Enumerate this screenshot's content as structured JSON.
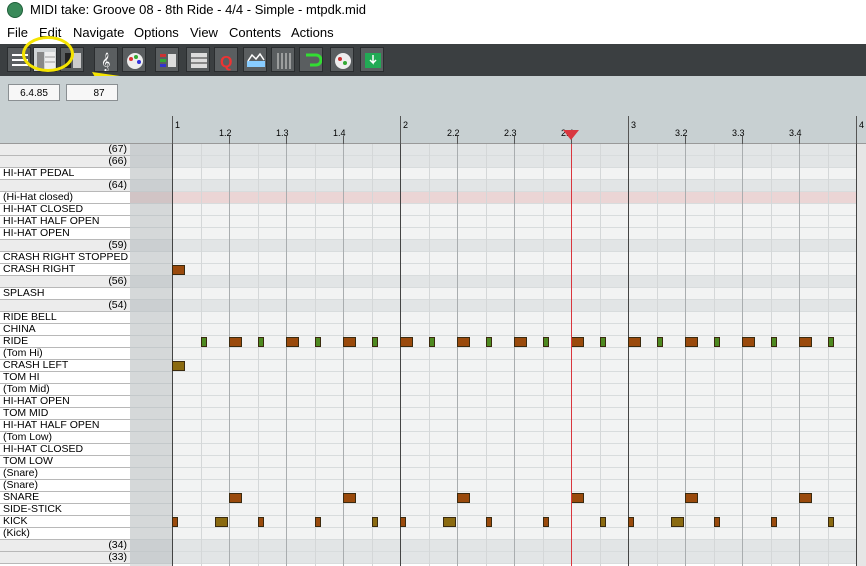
{
  "window": {
    "title": "MIDI take: Groove 08 - 8th Ride - 4/4 - Simple - mtpdk.mid"
  },
  "menu": [
    "File",
    "Edit",
    "Navigate",
    "Options",
    "View",
    "Contents",
    "Actions"
  ],
  "toolbar": {
    "buttons": [
      {
        "name": "piano-roll-mode-icon",
        "active": false
      },
      {
        "name": "named-notes-mode-icon",
        "active": true
      },
      {
        "name": "drum-grid-mode-icon",
        "active": false
      },
      {
        "name": "musical-notation-icon",
        "active": false
      },
      {
        "name": "color-palette-icon",
        "active": false
      },
      {
        "name": "velocity-color-icon",
        "active": false
      },
      {
        "name": "channel-grid-icon",
        "active": false
      },
      {
        "name": "quantize-icon",
        "active": false
      },
      {
        "name": "event-properties-icon",
        "active": false
      },
      {
        "name": "grid-lines-icon",
        "active": false
      },
      {
        "name": "loop-icon",
        "active": false
      },
      {
        "name": "step-input-icon",
        "active": false
      },
      {
        "name": "insert-note-icon",
        "active": false
      }
    ]
  },
  "info": {
    "position": "6.4.85",
    "length": "87"
  },
  "ruler": {
    "labels": [
      "1",
      "1.2",
      "1.3",
      "1.4",
      "2",
      "2.2",
      "2.3",
      "2.4",
      "3",
      "3.2",
      "3.3",
      "3.4",
      "4"
    ]
  },
  "keys": [
    {
      "name": "",
      "num": "(67)",
      "shade": "light"
    },
    {
      "name": "",
      "num": "(66)",
      "shade": "light"
    },
    {
      "name": "HI-HAT PEDAL",
      "num": "",
      "shade": "white"
    },
    {
      "name": "",
      "num": "(64)",
      "shade": "light"
    },
    {
      "name": "(Hi-Hat closed)",
      "num": "",
      "shade": "white"
    },
    {
      "name": "HI-HAT CLOSED",
      "num": "",
      "shade": "white"
    },
    {
      "name": "HI-HAT HALF OPEN",
      "num": "",
      "shade": "white"
    },
    {
      "name": "HI-HAT OPEN",
      "num": "",
      "shade": "white"
    },
    {
      "name": "",
      "num": "(59)",
      "shade": "light"
    },
    {
      "name": "CRASH RIGHT STOPPED",
      "num": "",
      "shade": "white"
    },
    {
      "name": "CRASH RIGHT",
      "num": "",
      "shade": "white"
    },
    {
      "name": "",
      "num": "(56)",
      "shade": "light"
    },
    {
      "name": "SPLASH",
      "num": "",
      "shade": "white"
    },
    {
      "name": "",
      "num": "(54)",
      "shade": "light"
    },
    {
      "name": "RIDE BELL",
      "num": "",
      "shade": "white"
    },
    {
      "name": "CHINA",
      "num": "",
      "shade": "white"
    },
    {
      "name": "RIDE",
      "num": "",
      "shade": "white"
    },
    {
      "name": "(Tom Hi)",
      "num": "",
      "shade": "white"
    },
    {
      "name": "CRASH LEFT",
      "num": "",
      "shade": "white"
    },
    {
      "name": "TOM HI",
      "num": "",
      "shade": "white"
    },
    {
      "name": "(Tom Mid)",
      "num": "",
      "shade": "white"
    },
    {
      "name": "HI-HAT OPEN",
      "num": "",
      "shade": "white"
    },
    {
      "name": "TOM MID",
      "num": "",
      "shade": "white"
    },
    {
      "name": "HI-HAT HALF OPEN",
      "num": "",
      "shade": "white"
    },
    {
      "name": "(Tom Low)",
      "num": "",
      "shade": "white"
    },
    {
      "name": "HI-HAT CLOSED",
      "num": "",
      "shade": "white"
    },
    {
      "name": "TOM LOW",
      "num": "",
      "shade": "white"
    },
    {
      "name": "(Snare)",
      "num": "",
      "shade": "white"
    },
    {
      "name": "(Snare)",
      "num": "",
      "shade": "white"
    },
    {
      "name": "SNARE",
      "num": "",
      "shade": "white"
    },
    {
      "name": "SIDE-STICK",
      "num": "",
      "shade": "white"
    },
    {
      "name": "KICK",
      "num": "",
      "shade": "white"
    },
    {
      "name": "(Kick)",
      "num": "",
      "shade": "white"
    },
    {
      "name": "",
      "num": "(34)",
      "shade": "light"
    },
    {
      "name": "",
      "num": "(33)",
      "shade": "light"
    }
  ],
  "notes": [
    {
      "row": 10,
      "beat": 0.0,
      "len": 0.22,
      "color": "#9a4a0c"
    },
    {
      "row": 18,
      "beat": 0.0,
      "len": 0.22,
      "color": "#8a6a10"
    },
    {
      "row": 16,
      "beat": 0.5,
      "len": 0.1,
      "color": "#4e8a20"
    },
    {
      "row": 16,
      "beat": 1.0,
      "len": 0.22,
      "color": "#9a4a0c"
    },
    {
      "row": 16,
      "beat": 1.5,
      "len": 0.1,
      "color": "#4e8a20"
    },
    {
      "row": 16,
      "beat": 2.0,
      "len": 0.22,
      "color": "#9a4a0c"
    },
    {
      "row": 16,
      "beat": 2.5,
      "len": 0.1,
      "color": "#4e8a20"
    },
    {
      "row": 16,
      "beat": 3.0,
      "len": 0.22,
      "color": "#9a4a0c"
    },
    {
      "row": 16,
      "beat": 3.5,
      "len": 0.1,
      "color": "#4e8a20"
    },
    {
      "row": 16,
      "beat": 4.0,
      "len": 0.22,
      "color": "#9a4a0c"
    },
    {
      "row": 16,
      "beat": 4.5,
      "len": 0.1,
      "color": "#4e8a20"
    },
    {
      "row": 16,
      "beat": 5.0,
      "len": 0.22,
      "color": "#9a4a0c"
    },
    {
      "row": 16,
      "beat": 5.5,
      "len": 0.1,
      "color": "#4e8a20"
    },
    {
      "row": 16,
      "beat": 6.0,
      "len": 0.22,
      "color": "#9a4a0c"
    },
    {
      "row": 16,
      "beat": 6.5,
      "len": 0.1,
      "color": "#4e8a20"
    },
    {
      "row": 16,
      "beat": 7.0,
      "len": 0.22,
      "color": "#9a4a0c"
    },
    {
      "row": 16,
      "beat": 7.5,
      "len": 0.1,
      "color": "#4e8a20"
    },
    {
      "row": 16,
      "beat": 8.0,
      "len": 0.22,
      "color": "#9a4a0c"
    },
    {
      "row": 16,
      "beat": 8.5,
      "len": 0.1,
      "color": "#4e8a20"
    },
    {
      "row": 16,
      "beat": 9.0,
      "len": 0.22,
      "color": "#9a4a0c"
    },
    {
      "row": 16,
      "beat": 9.5,
      "len": 0.1,
      "color": "#4e8a20"
    },
    {
      "row": 16,
      "beat": 10.0,
      "len": 0.22,
      "color": "#9a4a0c"
    },
    {
      "row": 16,
      "beat": 10.5,
      "len": 0.1,
      "color": "#4e8a20"
    },
    {
      "row": 16,
      "beat": 11.0,
      "len": 0.22,
      "color": "#9a4a0c"
    },
    {
      "row": 16,
      "beat": 11.5,
      "len": 0.1,
      "color": "#4e8a20"
    },
    {
      "row": 29,
      "beat": 1.0,
      "len": 0.22,
      "color": "#9a4a0c"
    },
    {
      "row": 29,
      "beat": 3.0,
      "len": 0.22,
      "color": "#9a4a0c"
    },
    {
      "row": 29,
      "beat": 5.0,
      "len": 0.22,
      "color": "#9a4a0c"
    },
    {
      "row": 29,
      "beat": 7.0,
      "len": 0.22,
      "color": "#9a4a0c"
    },
    {
      "row": 29,
      "beat": 9.0,
      "len": 0.22,
      "color": "#9a4a0c"
    },
    {
      "row": 29,
      "beat": 11.0,
      "len": 0.22,
      "color": "#9a4a0c"
    },
    {
      "row": 31,
      "beat": 0.0,
      "len": 0.1,
      "color": "#9a4a0c"
    },
    {
      "row": 31,
      "beat": 0.75,
      "len": 0.22,
      "color": "#8a6a10"
    },
    {
      "row": 31,
      "beat": 1.5,
      "len": 0.1,
      "color": "#9a4a0c"
    },
    {
      "row": 31,
      "beat": 2.5,
      "len": 0.1,
      "color": "#9a4a0c"
    },
    {
      "row": 31,
      "beat": 3.5,
      "len": 0.1,
      "color": "#8a6a10"
    },
    {
      "row": 31,
      "beat": 4.0,
      "len": 0.1,
      "color": "#9a4a0c"
    },
    {
      "row": 31,
      "beat": 4.75,
      "len": 0.22,
      "color": "#8a6a10"
    },
    {
      "row": 31,
      "beat": 5.5,
      "len": 0.1,
      "color": "#9a4a0c"
    },
    {
      "row": 31,
      "beat": 6.5,
      "len": 0.1,
      "color": "#9a4a0c"
    },
    {
      "row": 31,
      "beat": 7.5,
      "len": 0.1,
      "color": "#8a6a10"
    },
    {
      "row": 31,
      "beat": 8.0,
      "len": 0.1,
      "color": "#9a4a0c"
    },
    {
      "row": 31,
      "beat": 8.75,
      "len": 0.22,
      "color": "#8a6a10"
    },
    {
      "row": 31,
      "beat": 9.5,
      "len": 0.1,
      "color": "#9a4a0c"
    },
    {
      "row": 31,
      "beat": 10.5,
      "len": 0.1,
      "color": "#9a4a0c"
    },
    {
      "row": 31,
      "beat": 11.5,
      "len": 0.1,
      "color": "#8a6a10"
    }
  ],
  "highlighted_row": 4,
  "playhead_beat": 7.0,
  "colors": {
    "highlight": "#f5e400",
    "playhead": "#d9363e"
  }
}
